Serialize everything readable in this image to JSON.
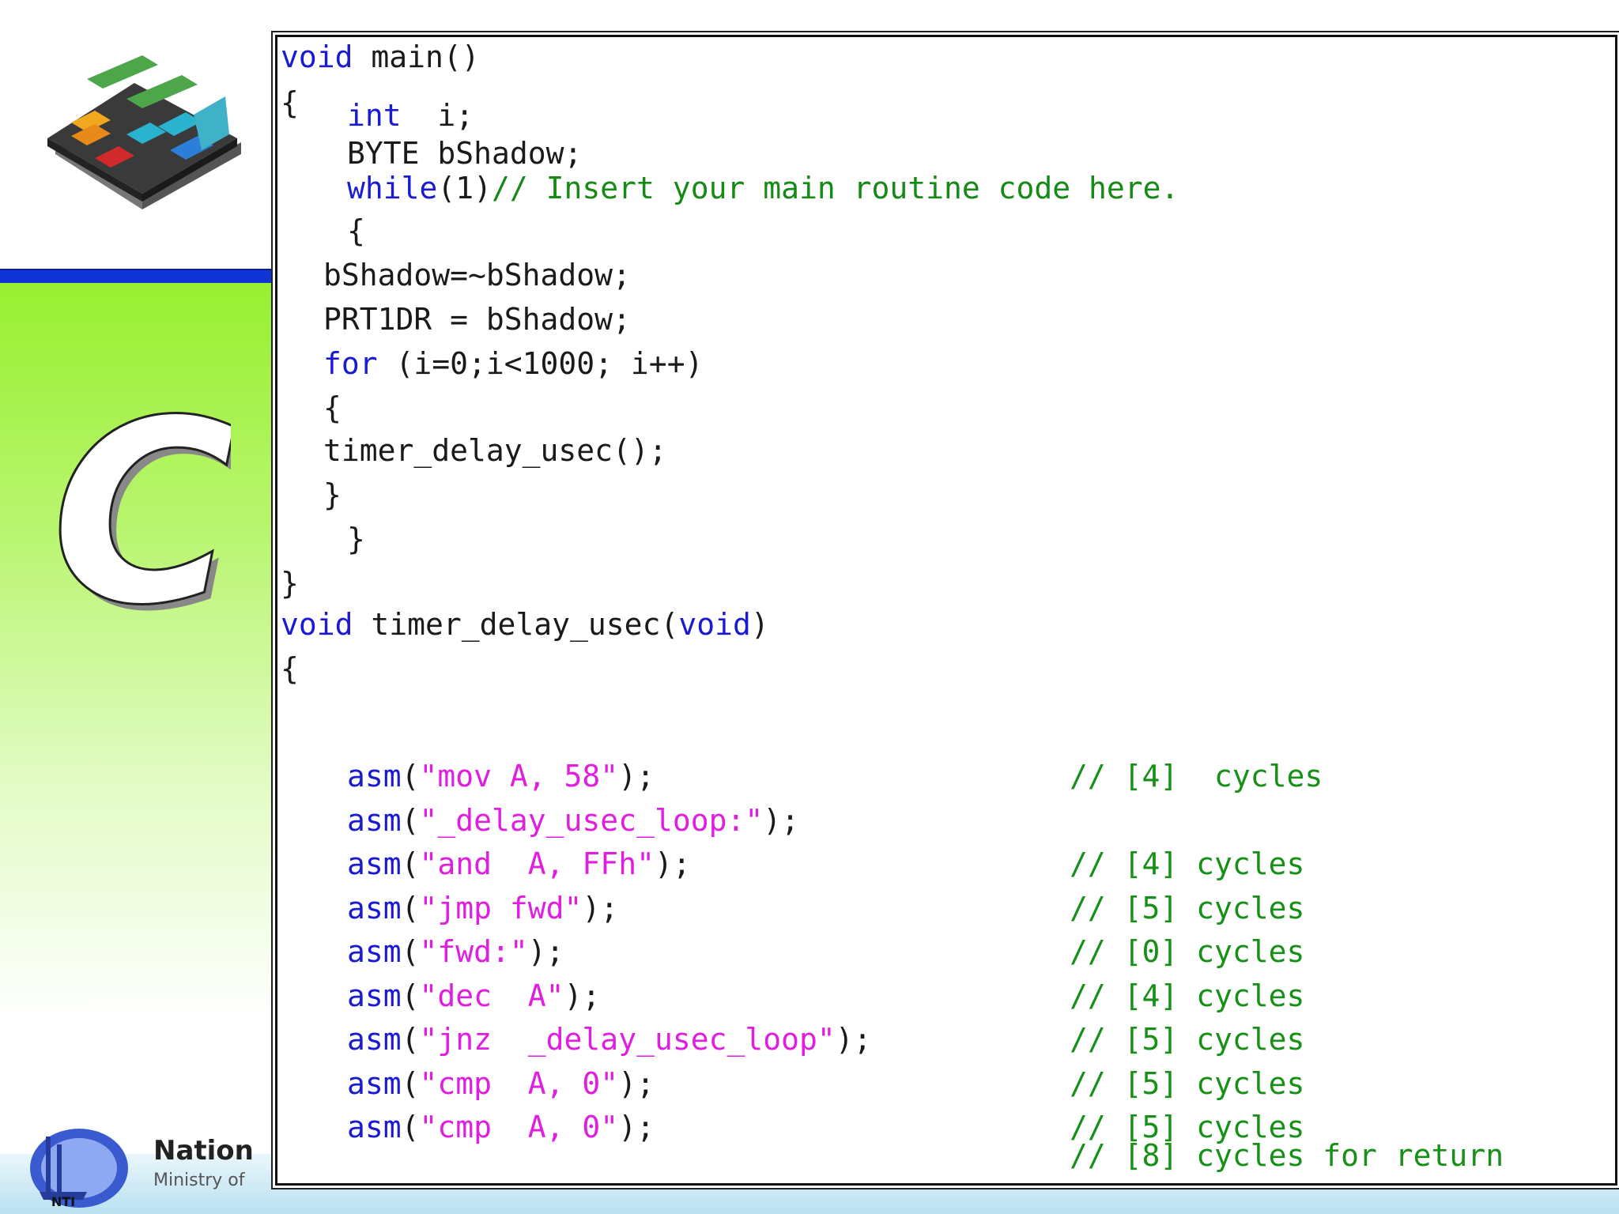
{
  "slide": {
    "big_letter": "C",
    "footer_title": "Nation",
    "footer_subtitle": "Ministry of"
  },
  "code": {
    "l1_kw": "void",
    "l1_rest": " main()",
    "l2_brace": "{",
    "l2_kw": "int",
    "l2_rest": "  i;",
    "l3": "BYTE bShadow;",
    "l4_kw": "while",
    "l4_rest": "(1)",
    "l4_comment": "// Insert your main routine code here.",
    "l5": "{",
    "l6": "bShadow=~bShadow;",
    "l7": "PRT1DR = bShadow;",
    "l8_kw": "for",
    "l8_rest": " (i=0;i<1000; i++)",
    "l9": "{",
    "l10": "timer_delay_usec();",
    "l11": "}",
    "l12": "}",
    "l13": "}",
    "l14_kw1": "void",
    "l14_mid": " timer_delay_usec(",
    "l14_kw2": "void",
    "l14_end": ")",
    "l15": "{",
    "asm_lines": [
      {
        "fn": "asm",
        "open": "(",
        "str": "\"mov A, 58\"",
        "close": ");",
        "comment": "// [4]  cycles"
      },
      {
        "fn": "asm",
        "open": "(",
        "str": "\"_delay_usec_loop:\"",
        "close": ");",
        "comment": ""
      },
      {
        "fn": "asm",
        "open": "(",
        "str": "\"and  A, FFh\"",
        "close": ");",
        "comment": "// [4] cycles"
      },
      {
        "fn": "asm",
        "open": "(",
        "str": "\"jmp fwd\"",
        "close": ");",
        "comment": "// [5] cycles"
      },
      {
        "fn": "asm",
        "open": "(",
        "str": "\"fwd:\"",
        "close": ");",
        "comment": "// [0] cycles"
      },
      {
        "fn": "asm",
        "open": "(",
        "str": "\"dec  A\"",
        "close": ");",
        "comment": "// [4] cycles"
      },
      {
        "fn": "asm",
        "open": "(",
        "str": "\"jnz  _delay_usec_loop\"",
        "close": ");",
        "comment": "// [5] cycles"
      },
      {
        "fn": "asm",
        "open": "(",
        "str": "\"cmp  A, 0\"",
        "close": ");",
        "comment": "// [5] cycles"
      },
      {
        "fn": "asm",
        "open": "(",
        "str": "\"cmp  A, 0\"",
        "close": ");",
        "comment": "// [5] cycles"
      }
    ],
    "final_comment": "// [8] cycles for return"
  }
}
